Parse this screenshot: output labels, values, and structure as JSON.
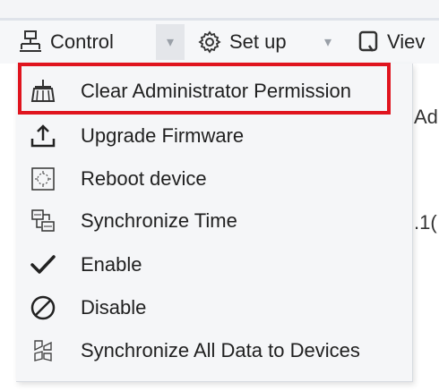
{
  "toolbar": {
    "control_label": "Control",
    "setup_label": "Set up",
    "view_label": "Viev",
    "dropdown_arrow": "▾"
  },
  "background_text": {
    "right_top": "Ad",
    "right_mid": ".1("
  },
  "menu": {
    "items": [
      {
        "label": "Clear Administrator Permission",
        "icon": "broom-icon"
      },
      {
        "label": "Upgrade Firmware",
        "icon": "upload-icon"
      },
      {
        "label": "Reboot device",
        "icon": "reboot-icon"
      },
      {
        "label": "Synchronize Time",
        "icon": "sync-time-icon"
      },
      {
        "label": "Enable",
        "icon": "checkmark-icon"
      },
      {
        "label": "Disable",
        "icon": "disable-icon"
      },
      {
        "label": "Synchronize All Data to Devices",
        "icon": "sync-data-icon"
      }
    ]
  },
  "colors": {
    "highlight_border": "#e0141e",
    "menu_bg": "#f5f6f8",
    "text": "#1f1f1f"
  }
}
